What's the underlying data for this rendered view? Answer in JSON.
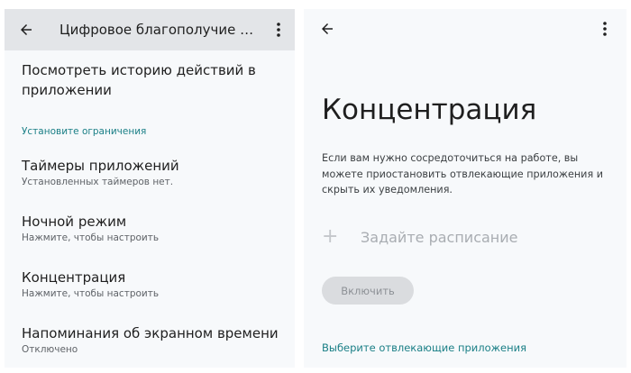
{
  "left_screen": {
    "toolbar": {
      "title": "Цифровое благополучие и родительский контроль",
      "back_icon": "arrow-back-icon",
      "more_icon": "more-vert-icon"
    },
    "view_history": "Посмотреть историю действий в приложении",
    "section_header": "Установите ограничения",
    "items": [
      {
        "title": "Таймеры приложений",
        "subtitle": "Установленных таймеров нет."
      },
      {
        "title": "Ночной режим",
        "subtitle": "Нажмите, чтобы настроить"
      },
      {
        "title": "Концентрация",
        "subtitle": "Нажмите, чтобы настроить"
      },
      {
        "title": "Напоминания об экранном времени",
        "subtitle": "Отключено"
      }
    ]
  },
  "right_screen": {
    "back_icon": "arrow-back-icon",
    "more_icon": "more-vert-icon",
    "title": "Концентрация",
    "description": "Если вам нужно сосредоточиться на работе, вы можете приостановить отвлекающие приложения и скрыть их уведомления.",
    "schedule_icon": "plus-icon",
    "schedule_label": "Задайте расписание",
    "enable_button": "Включить",
    "select_apps_link": "Выберите отвлекающие приложения"
  },
  "colors": {
    "accent": "#1a7f86",
    "toolbar_bg": "#e3e5e8",
    "screen_bg": "#f7f9fb"
  }
}
